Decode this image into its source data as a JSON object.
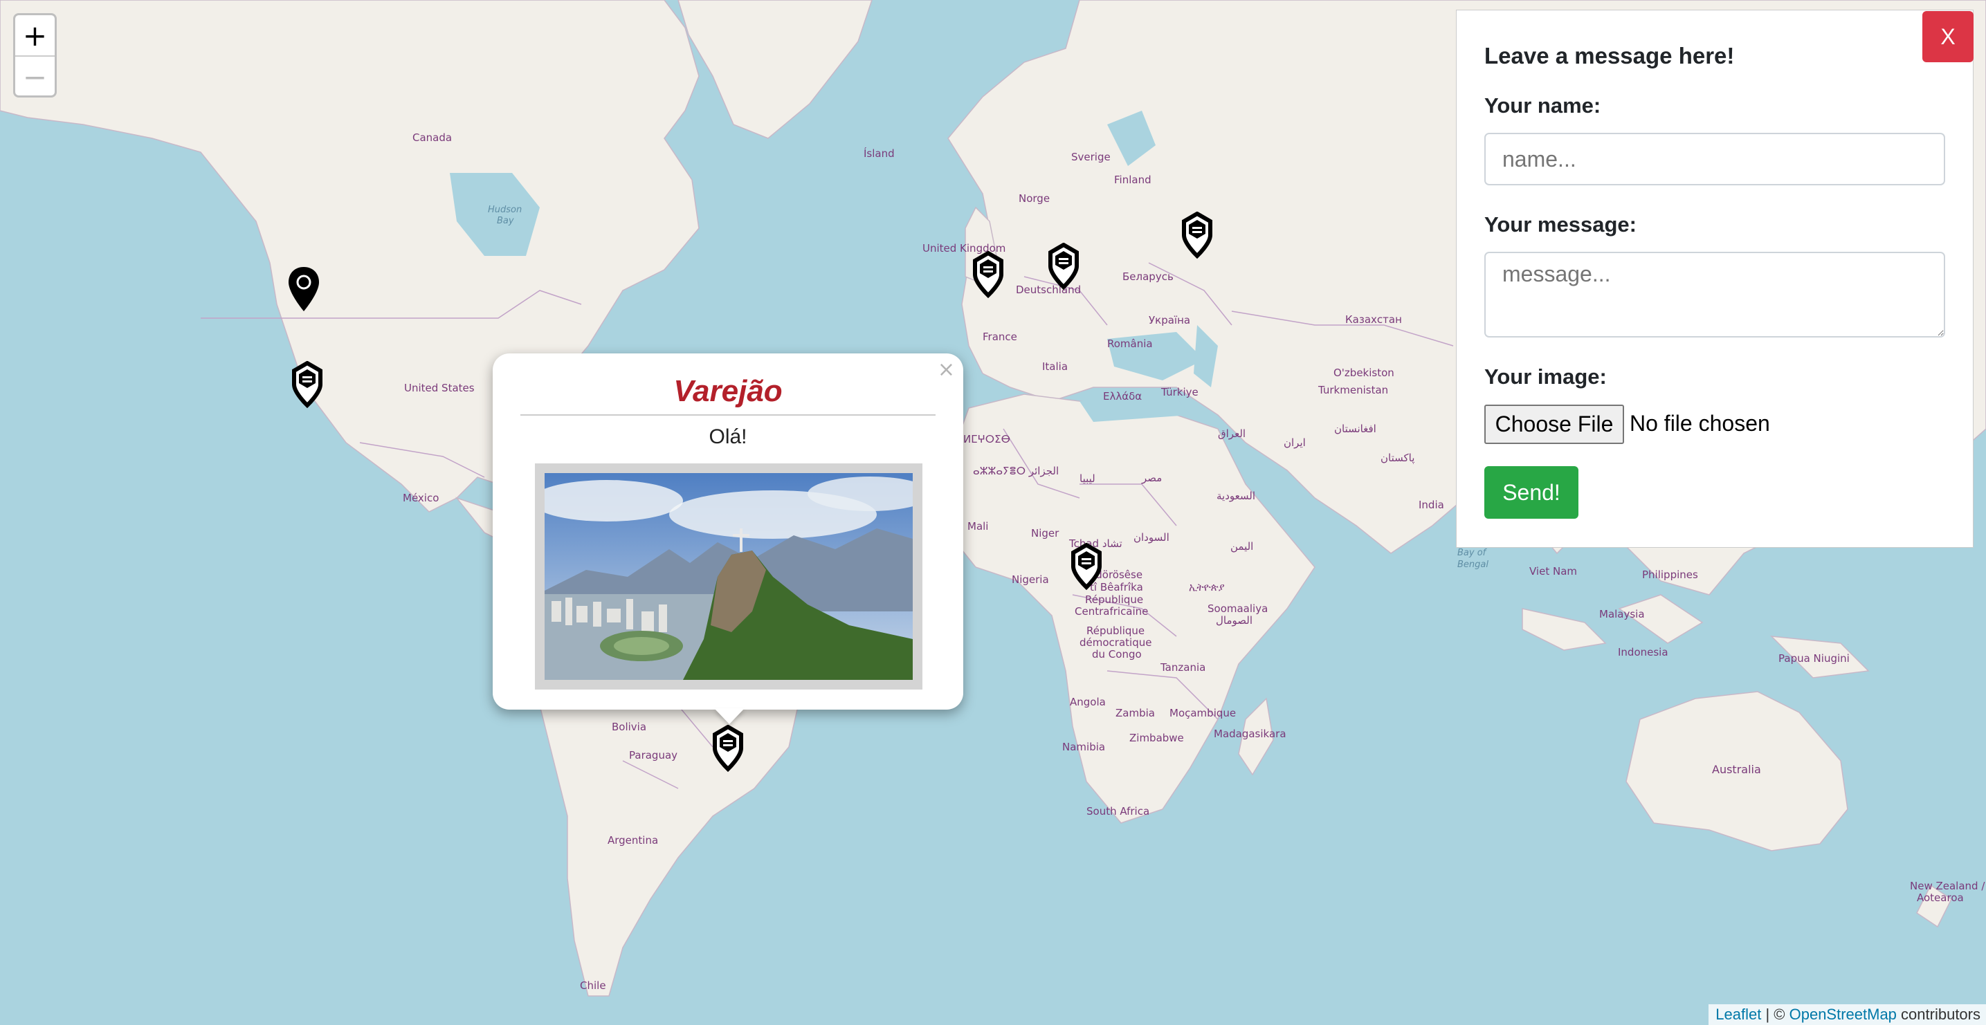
{
  "map": {
    "zoom_in": "+",
    "zoom_out": "−",
    "colors": {
      "water": "#aad3df",
      "land": "#f2efe9",
      "border": "#c2a3c8",
      "marker": "#000000"
    },
    "labels": [
      "Canada",
      "Hudson Bay",
      "United States",
      "México",
      "Ísland",
      "Sverige",
      "Finland",
      "Norge",
      "United Kingdom",
      "Deutschland",
      "France",
      "Беларусь",
      "Україна",
      "România",
      "Italia",
      "Türkiye",
      "Ελλάδα",
      "Казахстан",
      "O'zbekiston",
      "Turkmenistan",
      "العراق",
      "ایران",
      "افغانستان",
      "پاکستان",
      "India",
      "Bay of Bengal",
      "Viet Nam",
      "Philippines",
      "Malaysia",
      "Indonesia",
      "Papua Niugini",
      "Australia",
      "New Zealand / Aotearoa",
      "ⵍⵎⵖⵔⵉⴱ",
      "ⴰⵣⵣⴰⵢⴻⵔ الجزائر",
      "ليبيا",
      "مصر",
      "Mali",
      "Niger",
      "Tchad تشاد",
      "السودان",
      "السعودية",
      "اليمن",
      "Nigeria",
      "Ködörösêse tî Bêafrîka",
      "République Centrafricaine",
      "ኢትዮጵያ",
      "Soomaaliya الصومال",
      "République démocratique du Congo",
      "Tanzania",
      "Angola",
      "Zambia",
      "Moçambique",
      "Zimbabwe",
      "Madagasikara",
      "Namibia",
      "South Africa",
      "Bolivia",
      "Paraguay",
      "Argentina",
      "Chile"
    ]
  },
  "popup": {
    "title": "Varejão",
    "message": "Olá!",
    "close": "×",
    "image": "rio-christ-the-redeemer-photo"
  },
  "form": {
    "close": "X",
    "heading": "Leave a message here!",
    "name_label": "Your name:",
    "name_placeholder": "name...",
    "message_label": "Your message:",
    "message_placeholder": "message...",
    "image_label": "Your image:",
    "file_button": "Choose File",
    "file_status": "No file chosen",
    "send": "Send!"
  },
  "attribution": {
    "leaflet": "Leaflet",
    "sep": "| ©",
    "osm": "OpenStreetMap",
    "suffix": "contributors"
  }
}
